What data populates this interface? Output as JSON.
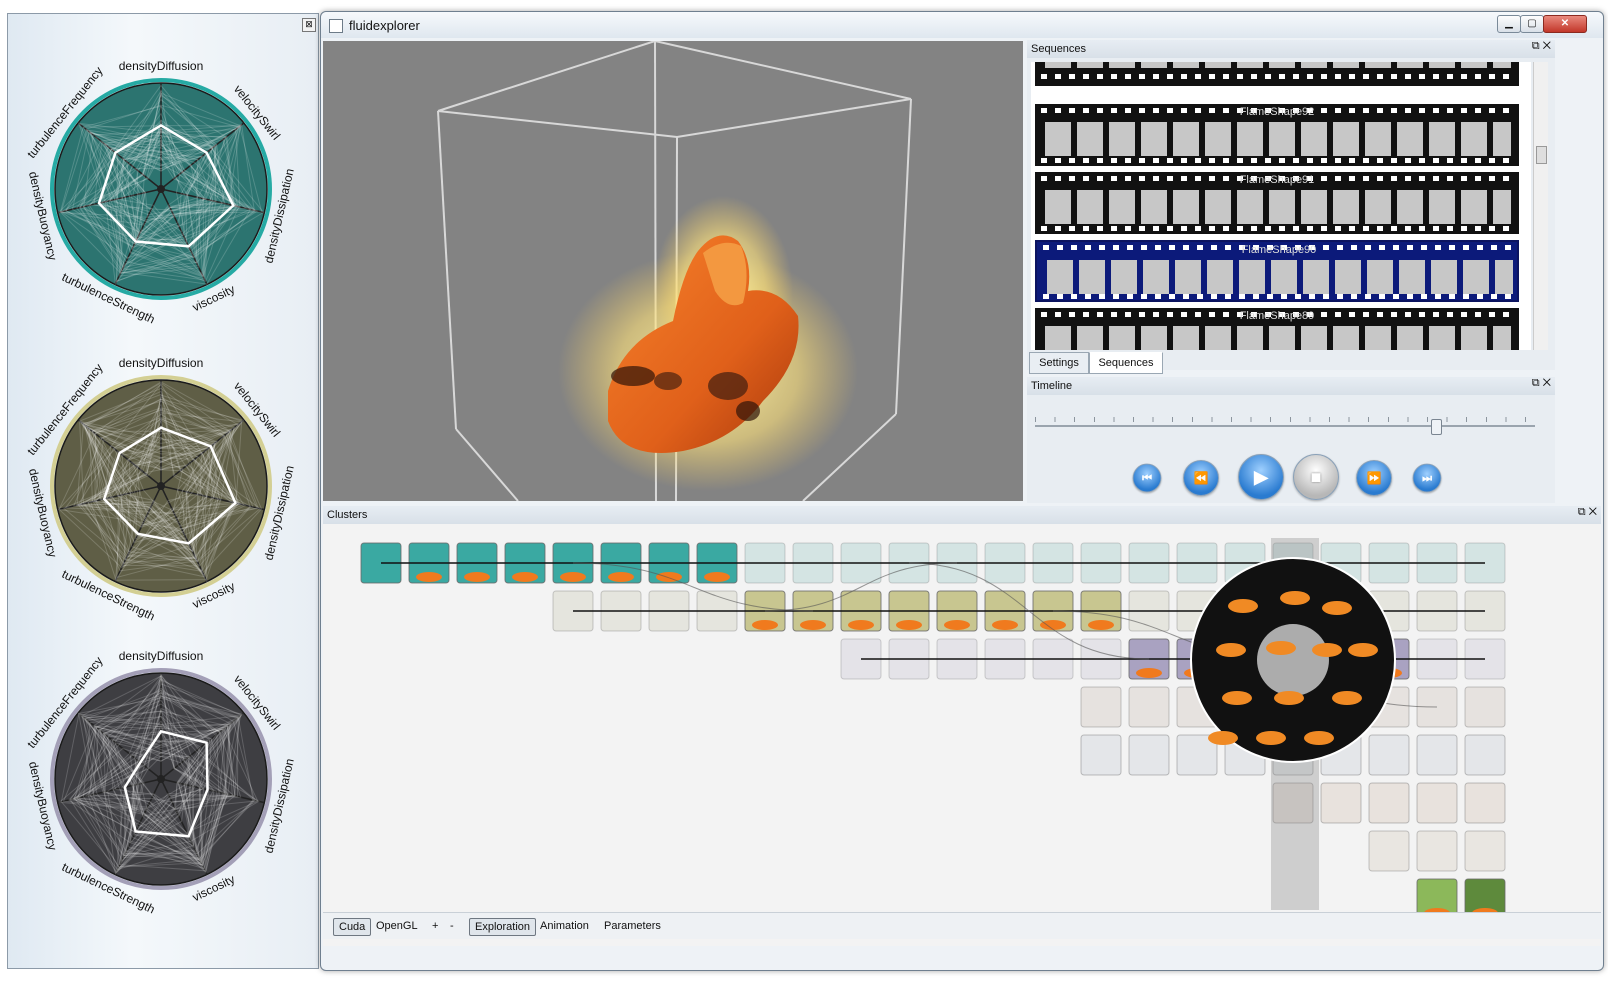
{
  "window": {
    "title": "fluidexplorer"
  },
  "radar_charts": [
    {
      "id": "cluster-teal",
      "fill": "#2c7470",
      "rim": "#26aaa4",
      "labels": [
        "densityDiffusion",
        "velocitySwirl",
        "densityDissipation",
        "viscosity",
        "turbulenceStrength",
        "densityBuoyancy",
        "turbulenceFrequency"
      ]
    },
    {
      "id": "cluster-olive",
      "fill": "#5f5e46",
      "rim": "#d3cf93",
      "labels": [
        "densityDiffusion",
        "velocitySwirl",
        "densityDissipation",
        "viscosity",
        "turbulenceStrength",
        "densityBuoyancy",
        "turbulenceFrequency"
      ]
    },
    {
      "id": "cluster-gray",
      "fill": "#3e3e42",
      "rim": "#a39fb7",
      "labels": [
        "densityDiffusion",
        "velocitySwirl",
        "densityDissipation",
        "viscosity",
        "turbulenceStrength",
        "densityBuoyancy",
        "turbulenceFrequency"
      ]
    }
  ],
  "sequences_dock": {
    "title": "Sequences",
    "items": [
      "FlameShape92",
      "FlameShape91",
      "FlameShape90",
      "FlameShape89"
    ],
    "selected": "FlameShape90",
    "tabs": [
      "Settings",
      "Sequences"
    ],
    "active_tab": "Sequences"
  },
  "timeline_dock": {
    "title": "Timeline",
    "position": 0.8,
    "buttons": [
      "skip-to-start",
      "rewind",
      "play",
      "stop",
      "fast-forward",
      "skip-to-end"
    ]
  },
  "clusters_dock": {
    "title": "Clusters"
  },
  "statusbar": {
    "items": [
      "Cuda",
      "OpenGL",
      "+",
      "-",
      "Exploration",
      "Animation",
      "Parameters"
    ],
    "active": [
      "Cuda",
      "Exploration"
    ]
  },
  "colors": {
    "teal": "#3aa9a2",
    "olive": "#c8c690",
    "lavender": "#a9a2c1",
    "flame": "#f07a1e"
  }
}
